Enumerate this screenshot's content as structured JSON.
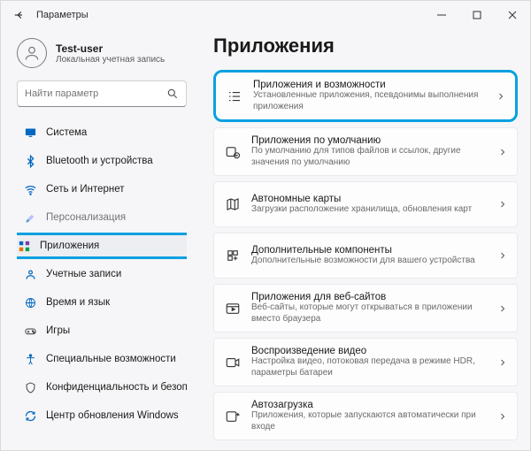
{
  "window": {
    "title": "Параметры"
  },
  "user": {
    "name": "Test-user",
    "subtitle": "Локальная учетная запись"
  },
  "search": {
    "placeholder": "Найти параметр"
  },
  "sidebar": {
    "items": [
      {
        "label": "Система"
      },
      {
        "label": "Bluetooth и устройства"
      },
      {
        "label": "Сеть и Интернет"
      },
      {
        "label": "Персонализация"
      },
      {
        "label": "Приложения"
      },
      {
        "label": "Учетные записи"
      },
      {
        "label": "Время и язык"
      },
      {
        "label": "Игры"
      },
      {
        "label": "Специальные возможности"
      },
      {
        "label": "Конфиденциальность и безопас"
      },
      {
        "label": "Центр обновления Windows"
      }
    ]
  },
  "page": {
    "title": "Приложения"
  },
  "cards": [
    {
      "title": "Приложения и возможности",
      "subtitle": "Установленные приложения, псевдонимы выполнения приложения"
    },
    {
      "title": "Приложения по умолчанию",
      "subtitle": "По умолчанию для типов файлов и ссылок, другие значения по умолчанию"
    },
    {
      "title": "Автономные карты",
      "subtitle": "Загрузки расположение хранилища, обновления карт"
    },
    {
      "title": "Дополнительные компоненты",
      "subtitle": "Дополнительные возможности для вашего устройства"
    },
    {
      "title": "Приложения для веб-сайтов",
      "subtitle": "Веб-сайты, которые могут открываться в приложении вместо браузера"
    },
    {
      "title": "Воспроизведение видео",
      "subtitle": "Настройка видео, потоковая передача в режиме HDR, параметры батареи"
    },
    {
      "title": "Автозагрузка",
      "subtitle": "Приложения, которые запускаются автоматически при входе"
    }
  ]
}
